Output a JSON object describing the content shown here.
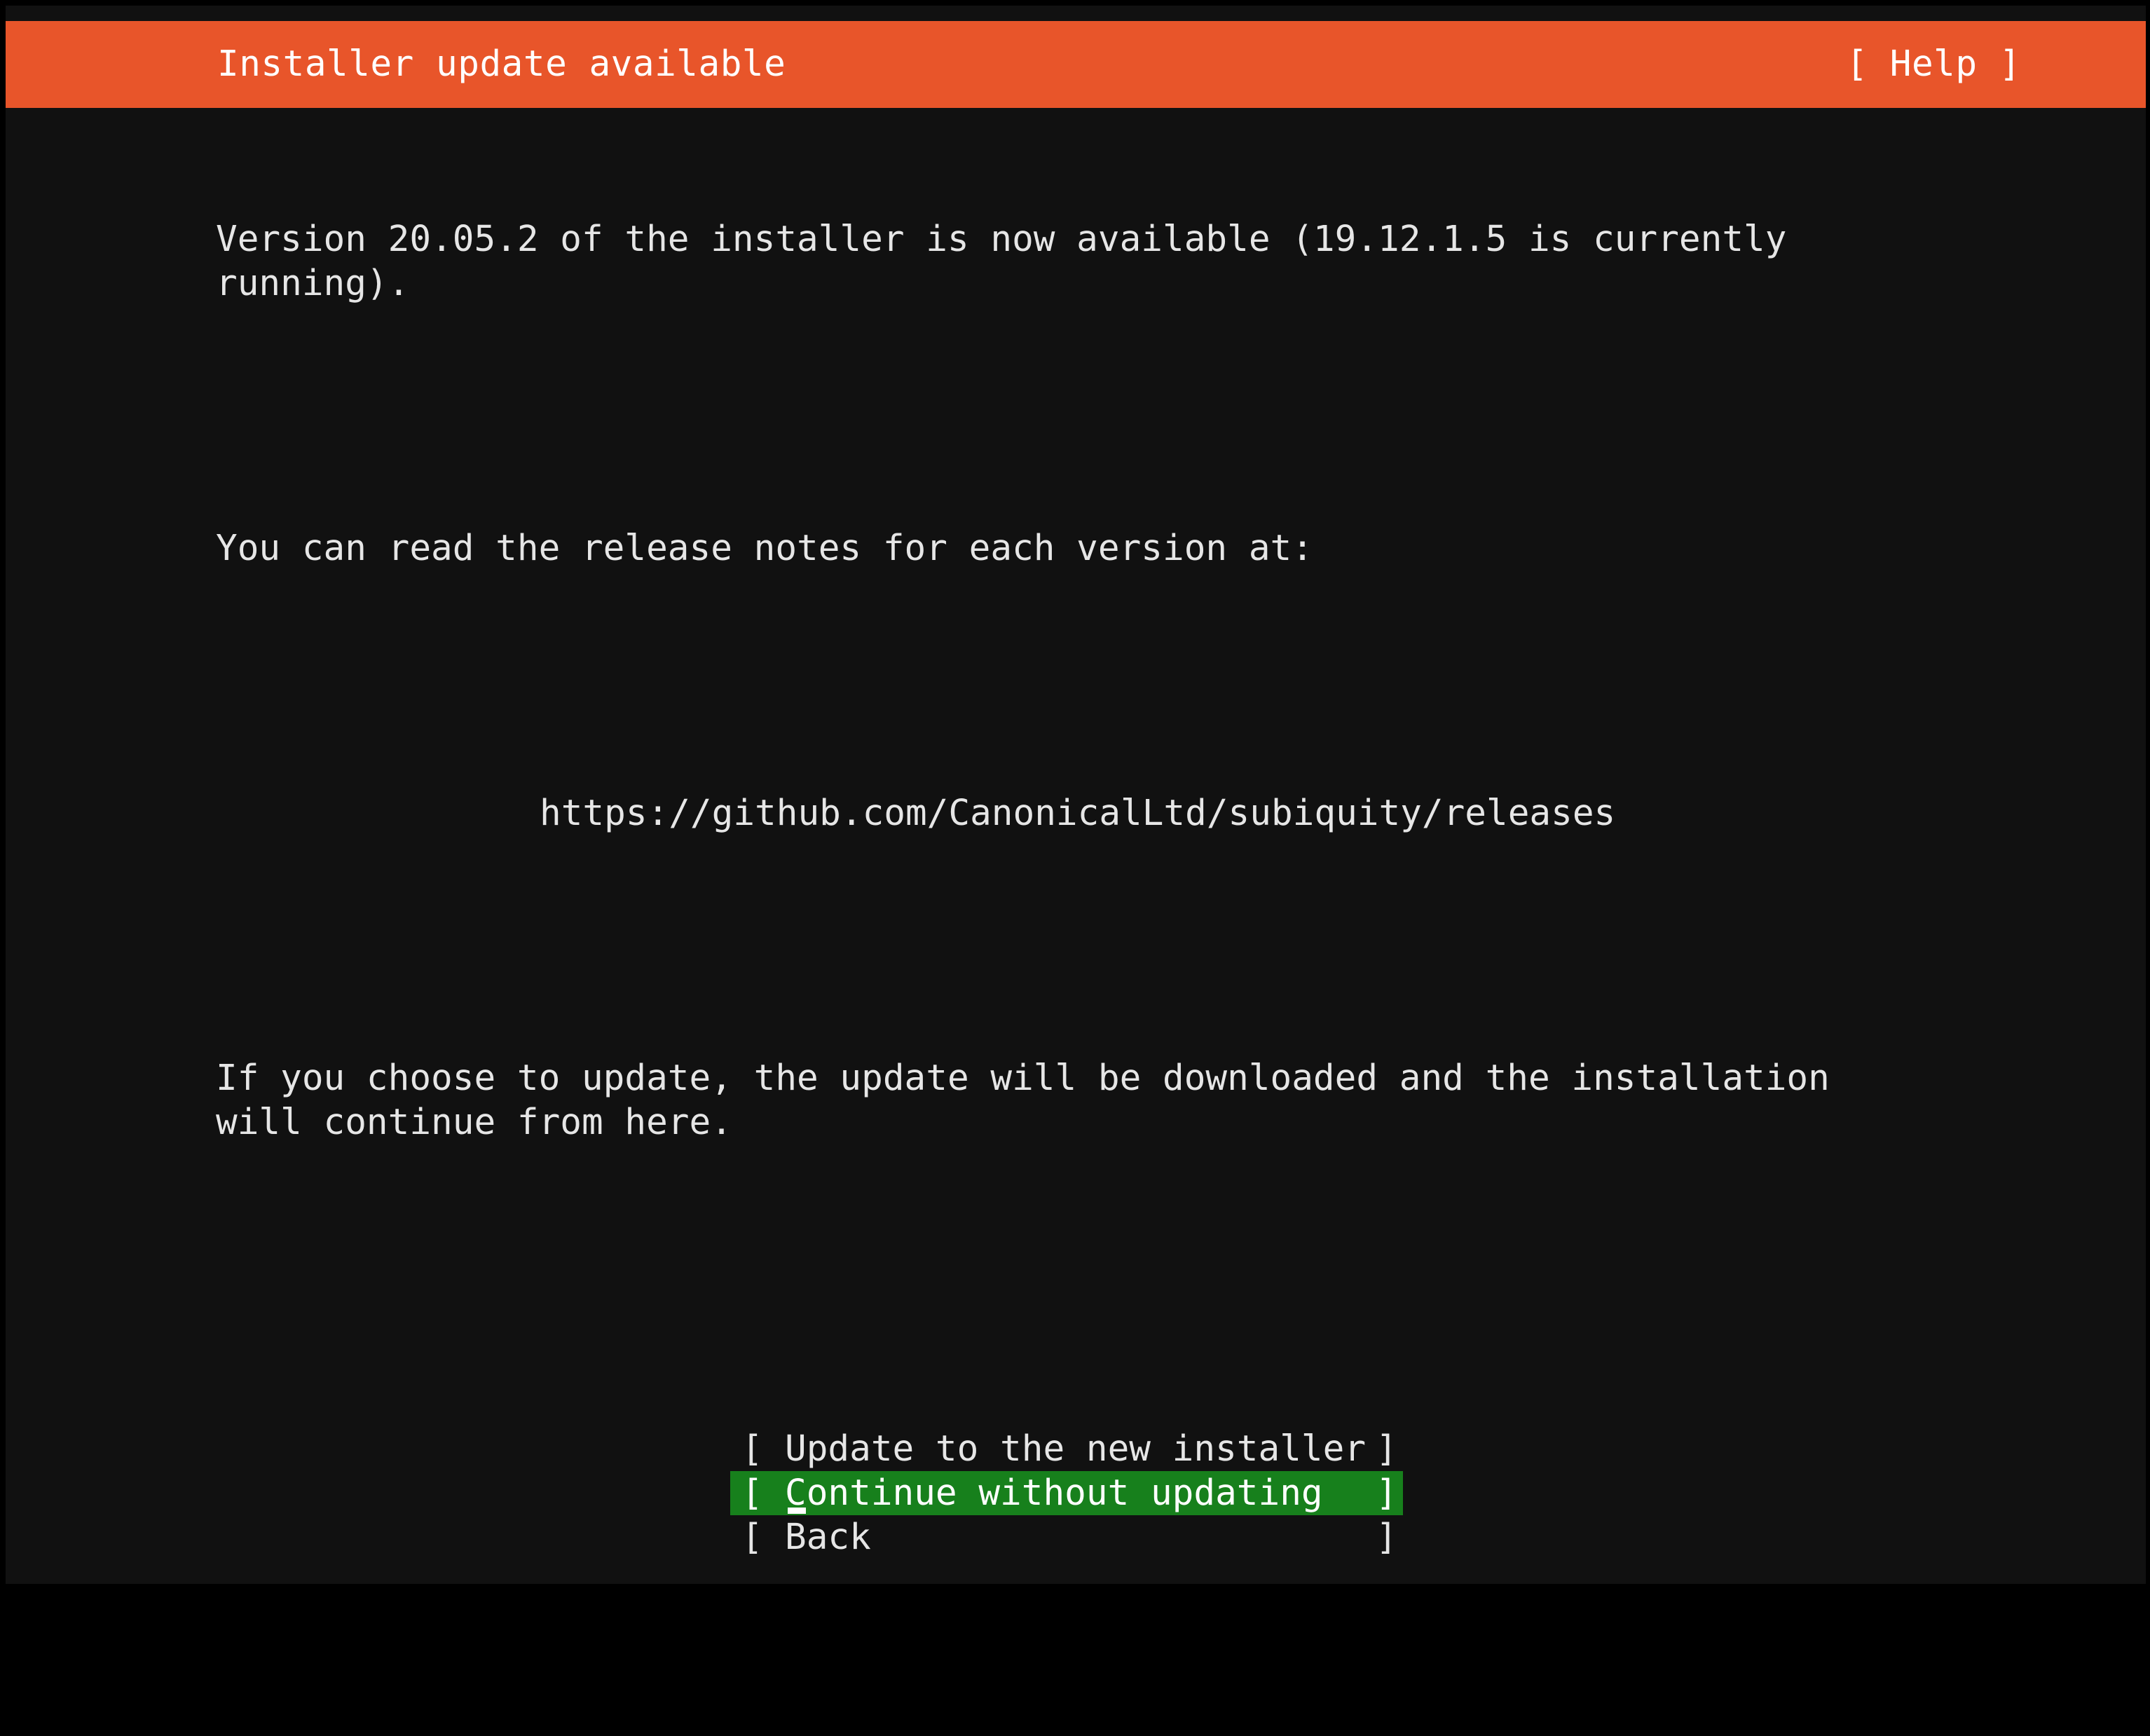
{
  "window": {
    "background_color": "#111111",
    "frame_color": "#000000"
  },
  "header": {
    "title": "Installer update available",
    "help_label": "[ Help ]",
    "background_color": "#e8552a",
    "text_color": "#ffffff"
  },
  "body": {
    "paragraph_1": "Version 20.05.2 of the installer is now available (19.12.1.5 is currently\nrunning).",
    "paragraph_2": "You can read the release notes for each version at:",
    "release_notes_url": "https://github.com/CanonicalLtd/subiquity/releases",
    "paragraph_3": "If you choose to update, the update will be downloaded and the installation\nwill continue from here.",
    "text_color": "#e6e6e6",
    "current_version": "19.12.1.5",
    "available_version": "20.05.2"
  },
  "buttons": {
    "bracket_open": "[",
    "bracket_close": "]",
    "selected_index": 1,
    "selected_background_color": "#17801c",
    "items": [
      {
        "label": "Update to the new installer",
        "selected": false
      },
      {
        "label": "Continue without updating",
        "selected": true
      },
      {
        "label": "Back",
        "selected": false
      }
    ]
  }
}
